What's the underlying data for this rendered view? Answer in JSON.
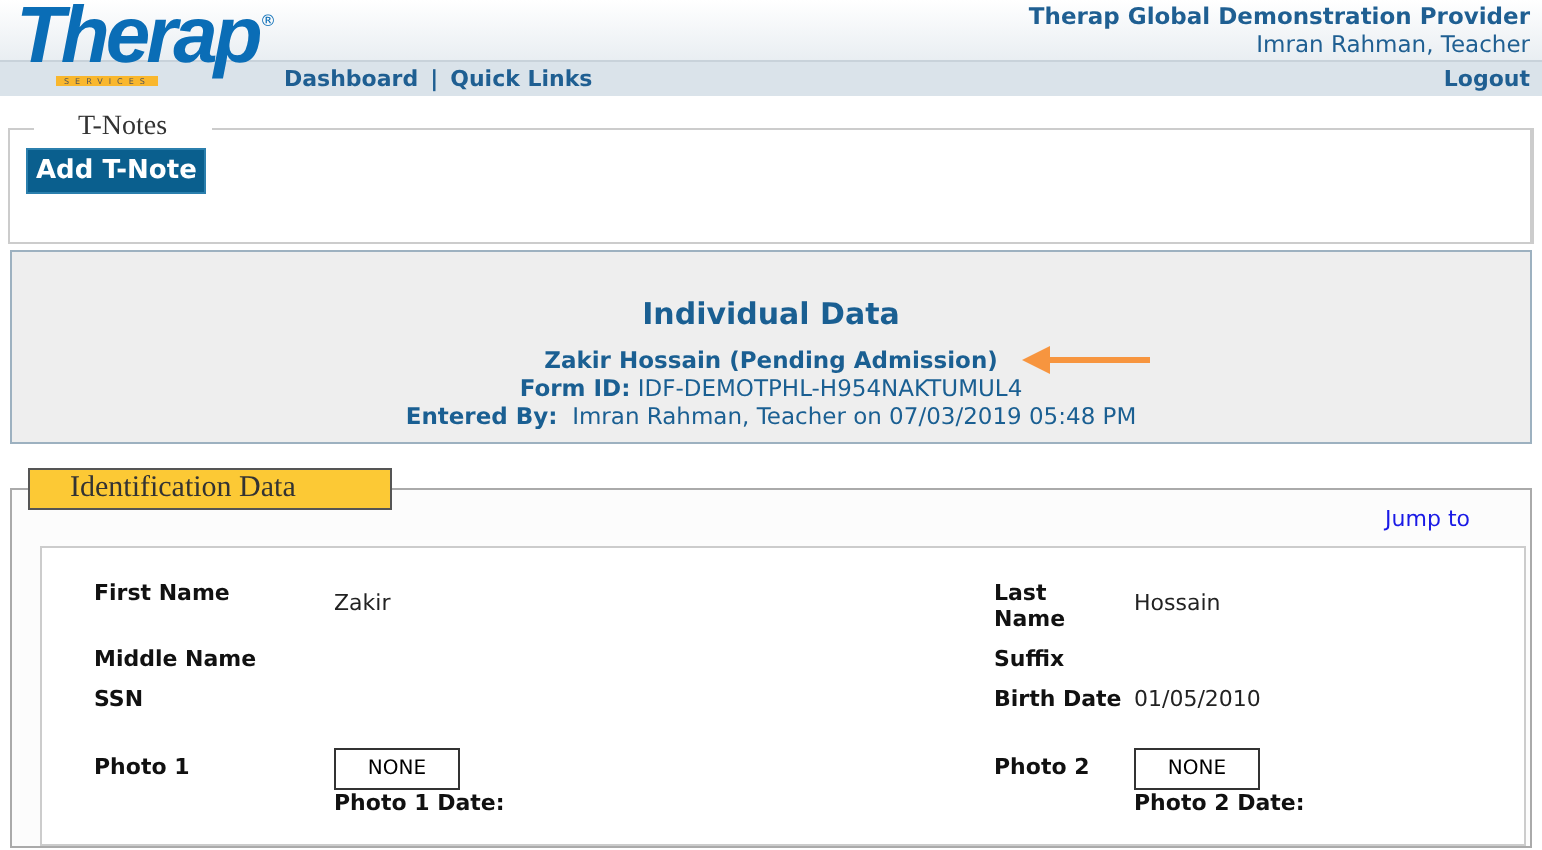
{
  "header": {
    "logo": {
      "word": "Therap",
      "mark": "®",
      "tagline": "SERVICES"
    },
    "provider": "Therap Global Demonstration Provider",
    "user": "Imran Rahman, Teacher"
  },
  "nav": {
    "links": [
      {
        "label": "Dashboard"
      },
      {
        "label": "Quick Links",
        "separator": "|"
      }
    ],
    "logout": "Logout"
  },
  "tnotes": {
    "legend": "T-Notes",
    "button": "Add T-Note"
  },
  "individual": {
    "title": "Individual Data",
    "name": "Zakir Hossain (Pending Admission)",
    "form_id_label": "Form ID:",
    "form_id": "IDF-DEMOTPHL-H954NAKTUMUL4",
    "entered_by_label": "Entered By:",
    "entered_by": "Imran Rahman, Teacher on 07/03/2019 05:48 PM"
  },
  "identification": {
    "legend": "Identification Data",
    "jump_to": "Jump to",
    "rows": [
      {
        "kind": "text",
        "left": {
          "label": "First Name",
          "value": "Zakir"
        },
        "right": {
          "label": "Last Name",
          "value": "Hossain"
        }
      },
      {
        "kind": "text",
        "left": {
          "label": "Middle Name"
        },
        "right": {
          "label": "Suffix"
        }
      },
      {
        "kind": "text",
        "left": {
          "label": "SSN"
        },
        "right": {
          "label": "Birth Date",
          "value": "01/05/2010"
        }
      },
      {
        "kind": "photo",
        "left": {
          "label": "Photo 1",
          "button": "NONE",
          "date_label": "Photo 1 Date:"
        },
        "right": {
          "label": "Photo 2",
          "button": "NONE",
          "date_label": "Photo 2 Date:"
        }
      }
    ]
  }
}
